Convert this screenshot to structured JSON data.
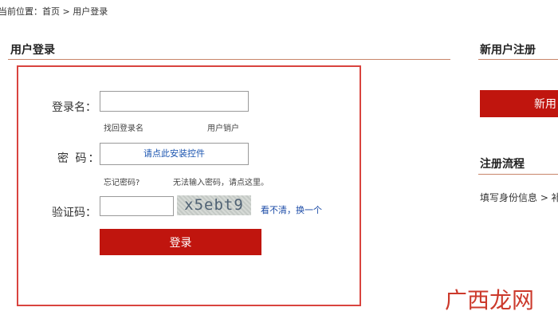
{
  "breadcrumb": {
    "prefix": "当前位置：",
    "home": "首页",
    "separator": " > ",
    "current": "用户登录"
  },
  "login_section": {
    "title": "用户登录",
    "username_label": "登录名：",
    "username_value": "",
    "recover_username": "找回登录名",
    "cancel_account": "用户销户",
    "password_label": "密 码：",
    "password_install_prompt": "请点此安装控件",
    "forgot_password": "忘记密码?",
    "cant_input_password": "无法输入密码，请点这里。",
    "captcha_label": "验证码：",
    "captcha_value": "",
    "captcha_text": "x5ebt9",
    "captcha_refresh": "看不清，换一个",
    "login_button": "登录"
  },
  "register_section": {
    "title": "新用户注册",
    "register_button": "新用"
  },
  "process_section": {
    "title": "注册流程",
    "first_step": "填写身份信息 > 补"
  },
  "watermark": "广西龙网",
  "colors": {
    "accent_red": "#c0150e",
    "box_border": "#d9443f",
    "link_blue": "#1a4aa6",
    "rule": "#c8866a"
  }
}
